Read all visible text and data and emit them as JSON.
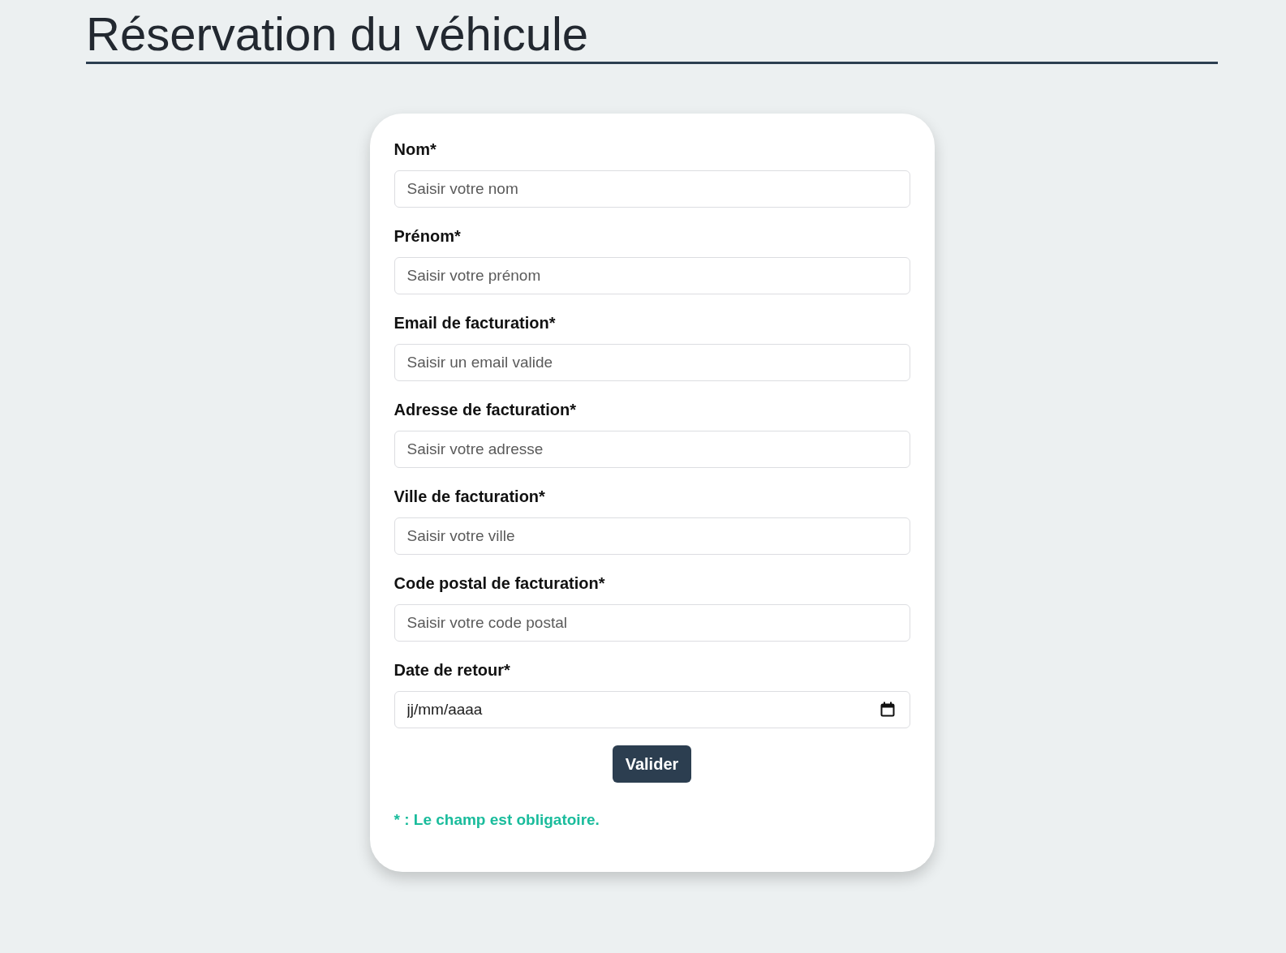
{
  "page": {
    "title": "Réservation du véhicule"
  },
  "form": {
    "fields": [
      {
        "kind": "text",
        "label": "Nom*",
        "placeholder": "Saisir votre nom"
      },
      {
        "kind": "text",
        "label": "Prénom*",
        "placeholder": "Saisir votre prénom"
      },
      {
        "kind": "email",
        "label": "Email de facturation*",
        "placeholder": "Saisir un email valide"
      },
      {
        "kind": "text",
        "label": "Adresse de facturation*",
        "placeholder": "Saisir votre adresse"
      },
      {
        "kind": "text",
        "label": "Ville de facturation*",
        "placeholder": "Saisir votre ville"
      },
      {
        "kind": "text",
        "label": "Code postal de facturation*",
        "placeholder": "Saisir votre code postal"
      },
      {
        "kind": "date",
        "label": "Date de retour*",
        "placeholder": "jj/mm/aaaa"
      }
    ],
    "submit_button": "Valider",
    "note": "* : Le champ est obligatoire."
  }
}
